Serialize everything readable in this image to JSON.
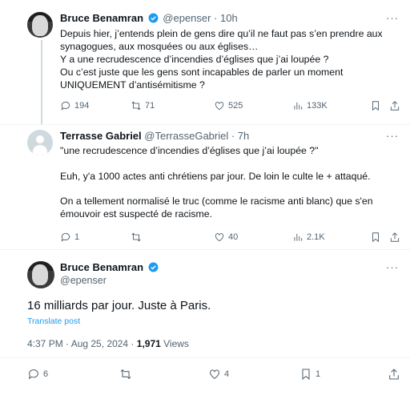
{
  "tweets": [
    {
      "name": "Bruce Benamran",
      "handle": "@epenser",
      "time": "10h",
      "lines": [
        "Depuis hier, j’entends plein de gens dire qu’il ne faut pas s’en prendre aux",
        "synagogues, aux mosquées ou aux églises…",
        "Y a une recrudescence d’incendies d’églises que j’ai loupée ?",
        "Ou c’est juste que les gens sont incapables de parler un moment",
        "UNIQUEMENT d’antisémitisme ?"
      ],
      "replies": "194",
      "reposts": "71",
      "likes": "525",
      "views": "133K"
    },
    {
      "name": "Terrasse Gabriel",
      "handle": "@TerrasseGabriel",
      "time": "7h",
      "lines": [
        "\"une recrudescence d’incendies d’églises que j’ai loupée ?\"",
        "",
        "Euh, y'a 1000 actes anti chrétiens par jour. De loin le culte le + attaqué.",
        "",
        "On a tellement normalisé le truc (comme le racisme anti blanc) que s'en",
        "émouvoir est suspecté de racisme."
      ],
      "replies": "1",
      "reposts": "",
      "likes": "40",
      "views": "2.1K"
    }
  ],
  "main": {
    "name": "Bruce Benamran",
    "handle": "@epenser",
    "text": "16 milliards par jour. Juste à Paris.",
    "translate": "Translate post",
    "timestamp": "4:37 PM · Aug 25, 2024 · ",
    "views_count": "1,971",
    "views_label": " Views",
    "replies": "6",
    "reposts": "",
    "likes": "4",
    "bookmarks": "1"
  },
  "ui": {
    "more": "···",
    "dot": " · "
  },
  "colors": {
    "accent": "#1d9bf0",
    "secondary_text": "#536471",
    "divider": "#eff3f4"
  }
}
